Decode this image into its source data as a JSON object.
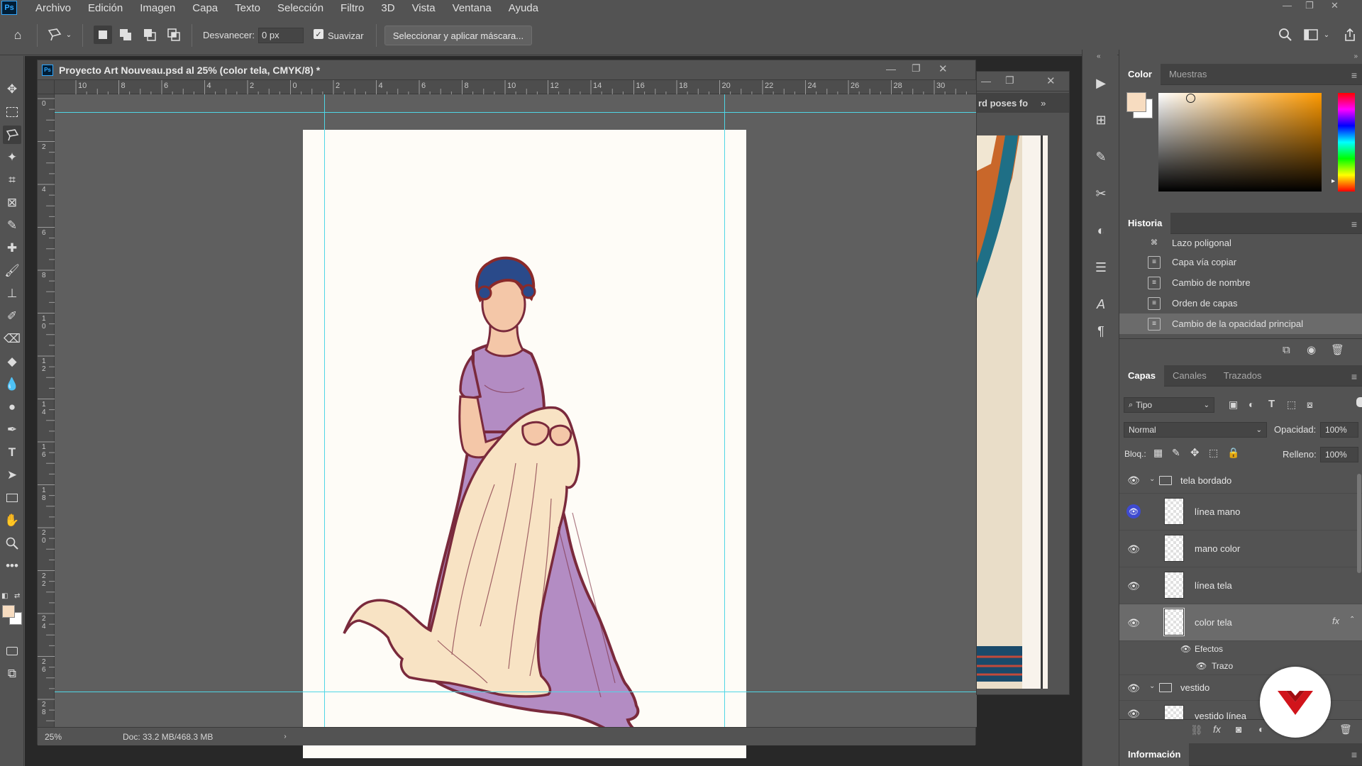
{
  "app": {
    "logo": "Ps"
  },
  "menu": [
    "Archivo",
    "Edición",
    "Imagen",
    "Capa",
    "Texto",
    "Selección",
    "Filtro",
    "3D",
    "Vista",
    "Ventana",
    "Ayuda"
  ],
  "options": {
    "feather_label": "Desvanecer:",
    "feather_value": "0 px",
    "antialias_label": "Suavizar",
    "antialias_checked": true,
    "mask_button": "Seleccionar y aplicar máscara..."
  },
  "document": {
    "title": "Proyecto Art Nouveau.psd al 25% (color tela, CMYK/8) *",
    "zoom": "25%",
    "doc_size": "Doc: 33.2 MB/468.3 MB",
    "ruler_h": [
      "10",
      "8",
      "6",
      "4",
      "2",
      "0",
      "2",
      "4",
      "6",
      "8",
      "10",
      "12",
      "14",
      "16",
      "18",
      "20",
      "22",
      "24",
      "26",
      "28",
      "30"
    ],
    "ruler_v": [
      "0",
      "2",
      "4",
      "6",
      "8",
      "1\n0",
      "1\n2",
      "1\n4",
      "1\n6",
      "1\n8",
      "2\n0",
      "2\n2",
      "2\n4",
      "2\n6",
      "2\n8"
    ]
  },
  "document2": {
    "title_fragment": "rd poses fo"
  },
  "panels": {
    "color": {
      "tabs": [
        "Color",
        "Muestras"
      ],
      "foreground": "#f7dcc0",
      "background": "#ffffff"
    },
    "history": {
      "title": "Historia",
      "items": [
        "Lazo poligonal",
        "Capa vía copiar",
        "Cambio de nombre",
        "Orden de capas",
        "Cambio de la opacidad principal"
      ],
      "selected": 4
    },
    "layers": {
      "tabs": [
        "Capas",
        "Canales",
        "Trazados"
      ],
      "filter_label": "Tipo",
      "blend_mode": "Normal",
      "opacity_label": "Opacidad:",
      "opacity_value": "100%",
      "lock_label": "Bloq.:",
      "fill_label": "Relleno:",
      "fill_value": "100%",
      "rows": [
        {
          "name": "tela bordado",
          "kind": "group"
        },
        {
          "name": "línea mano",
          "kind": "layer"
        },
        {
          "name": "mano color",
          "kind": "layer"
        },
        {
          "name": "línea tela",
          "kind": "layer"
        },
        {
          "name": "color tela",
          "kind": "layer",
          "selected": true,
          "fx": "fx"
        },
        {
          "name": "Efectos",
          "kind": "effects"
        },
        {
          "name": "Trazo",
          "kind": "effect"
        },
        {
          "name": "vestido",
          "kind": "group"
        },
        {
          "name": "vestido línea",
          "kind": "layer"
        }
      ]
    },
    "info": {
      "title": "Información"
    }
  },
  "colors": {
    "accent_guide": "#4fd6e6",
    "dress": "#b38cc3",
    "cloth": "#f8e3c4",
    "outline": "#7a2a3c",
    "hair": "#2a4a8a",
    "skin": "#f4c7a8",
    "brand_red": "#d1141b"
  }
}
